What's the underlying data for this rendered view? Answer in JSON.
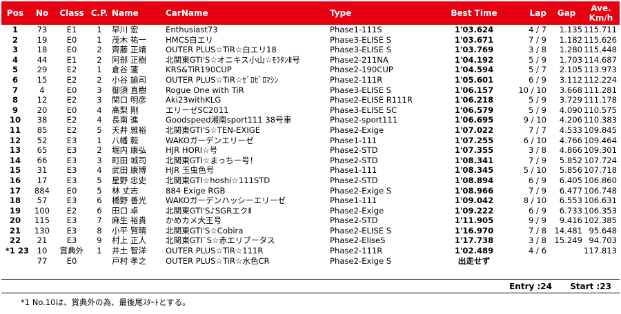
{
  "headers": {
    "pos": "Pos",
    "no": "No",
    "class": "Class",
    "cp": "C.P.",
    "name": "Name",
    "carname": "CarName",
    "type": "Type",
    "best": "Best Time",
    "lap": "Lap",
    "gap": "Gap",
    "ave1": "Ave.",
    "ave2": "Km/h"
  },
  "rows": [
    {
      "pos": "1",
      "no": "73",
      "cls": "E1",
      "cp": "1",
      "name": "早川 宏",
      "car": "Enthusiast73",
      "type": "Phase1-111S",
      "best": "1'03.624",
      "lap": "4 / 7",
      "gap": "1.135",
      "ave": "115.711"
    },
    {
      "pos": "2",
      "no": "19",
      "cls": "E0",
      "cp": "1",
      "name": "茂木 祐一",
      "car": "HMCS白エリ",
      "type": "Phase3-ELISE S",
      "best": "1'03.671",
      "lap": "7 / 9",
      "gap": "1.182",
      "ave": "115.626"
    },
    {
      "pos": "3",
      "no": "18",
      "cls": "E0",
      "cp": "2",
      "name": "齊藤 正靖",
      "car": "OUTER PLUS☆TiR☆白エリ18",
      "type": "Phase3-ELISE S",
      "best": "1'03.769",
      "lap": "3 / 8",
      "gap": "1.280",
      "ave": "115.448"
    },
    {
      "pos": "4",
      "no": "44",
      "cls": "E1",
      "cp": "2",
      "name": "阿部 正樹",
      "car": "北関東GTI'S☆オニキス小山☆ﾓﾗﾀﾝⅡ号",
      "type": "Phase2-211NA",
      "best": "1'04.192",
      "lap": "5 / 9",
      "gap": "1.703",
      "ave": "114.687"
    },
    {
      "pos": "5",
      "no": "29",
      "cls": "E2",
      "cp": "1",
      "name": "倉谷 蓮",
      "car": "KRS&TiR190CUP",
      "type": "Phase2-190CUP",
      "best": "1'04.594",
      "lap": "5 / 7",
      "gap": "2.105",
      "ave": "113.973"
    },
    {
      "pos": "6",
      "no": "15",
      "cls": "E2",
      "cp": "2",
      "name": "小谷 諭司",
      "car": "OUTER PLUS☆TiR☆ｾﾞﾛｾﾞﾛﾏｼﾝ",
      "type": "Phase2-111R",
      "best": "1'05.601",
      "lap": "6 / 9",
      "gap": "3.112",
      "ave": "112.224"
    },
    {
      "pos": "7",
      "no": "4",
      "cls": "E0",
      "cp": "3",
      "name": "御須 直樹",
      "car": "Rogue One with TiR",
      "type": "Phase3-ELISE S",
      "best": "1'06.157",
      "lap": "10 / 10",
      "gap": "3.668",
      "ave": "111.281"
    },
    {
      "pos": "8",
      "no": "12",
      "cls": "E2",
      "cp": "3",
      "name": "関口 明彦",
      "car": "Aki23withKLG",
      "type": "Phase2-ELISE R111R",
      "best": "1'06.218",
      "lap": "5 / 9",
      "gap": "3.729",
      "ave": "111.178"
    },
    {
      "pos": "9",
      "no": "20",
      "cls": "E0",
      "cp": "4",
      "name": "高梨 剛",
      "car": "エリーゼSC2011",
      "type": "Phase3-ELISE SC",
      "best": "1'06.579",
      "lap": "5 / 9",
      "gap": "4.090",
      "ave": "110.575"
    },
    {
      "pos": "10",
      "no": "38",
      "cls": "E2",
      "cp": "4",
      "name": "長南 進",
      "car": "Goodspeed湘南sport111 38号車",
      "type": "Phase2-sport111",
      "best": "1'06.695",
      "lap": "9 / 10",
      "gap": "4.206",
      "ave": "110.383"
    },
    {
      "pos": "11",
      "no": "85",
      "cls": "E2",
      "cp": "5",
      "name": "天井 雅裕",
      "car": "北関東GTI'S☆TEN-EXIGE",
      "type": "Phase2-Exige",
      "best": "1'07.022",
      "lap": "7 / 7",
      "gap": "4.533",
      "ave": "109.845"
    },
    {
      "pos": "12",
      "no": "52",
      "cls": "E3",
      "cp": "1",
      "name": "八幡 毅",
      "car": "WAKOガーデンエリーゼ",
      "type": "Phase1-111",
      "best": "1'07.255",
      "lap": "6 / 10",
      "gap": "4.766",
      "ave": "109.464"
    },
    {
      "pos": "13",
      "no": "65",
      "cls": "E3",
      "cp": "2",
      "name": "堀内 康弘",
      "car": "HJR HORI☆号",
      "type": "Phase2-STD",
      "best": "1'07.355",
      "lap": "3 / 8",
      "gap": "4.866",
      "ave": "109.301"
    },
    {
      "pos": "14",
      "no": "66",
      "cls": "E3",
      "cp": "3",
      "name": "町田 城司",
      "car": "北関東GTI☆まっちー号！",
      "type": "Phase2-STD",
      "best": "1'08.341",
      "lap": "7 / 9",
      "gap": "5.852",
      "ave": "107.724"
    },
    {
      "pos": "15",
      "no": "31",
      "cls": "E3",
      "cp": "4",
      "name": "武田 康博",
      "car": "HJR 玉虫色号",
      "type": "Phase1-111",
      "best": "1'08.345",
      "lap": "5 / 10",
      "gap": "5.856",
      "ave": "107.718"
    },
    {
      "pos": "16",
      "no": "17",
      "cls": "E3",
      "cp": "5",
      "name": "星野 忠史",
      "car": "北関東GTI☆hoshi☆111STD",
      "type": "Phase2-STD",
      "best": "1'08.894",
      "lap": "6 / 9",
      "gap": "6.405",
      "ave": "106.860"
    },
    {
      "pos": "17",
      "no": "884",
      "cls": "E0",
      "cp": "5",
      "name": "林 丈志",
      "car": "884 Exige RGB",
      "type": "Phase2-Exige S",
      "best": "1'08.966",
      "lap": "7 / 9",
      "gap": "6.477",
      "ave": "106.748"
    },
    {
      "pos": "18",
      "no": "57",
      "cls": "E3",
      "cp": "6",
      "name": "橋野 善光",
      "car": "WAKOガーデンハッシーエリーゼ",
      "type": "Phase1-111",
      "best": "1'09.042",
      "lap": "8 / 10",
      "gap": "6.553",
      "ave": "106.631"
    },
    {
      "pos": "19",
      "no": "100",
      "cls": "E2",
      "cp": "6",
      "name": "田口 卓",
      "car": "北関東GTI'S♪SGRエクⅡ",
      "type": "Phase2-Exige",
      "best": "1'09.222",
      "lap": "6 / 9",
      "gap": "6.733",
      "ave": "106.353"
    },
    {
      "pos": "20",
      "no": "115",
      "cls": "E3",
      "cp": "7",
      "name": "麻生 裕貴",
      "car": "かめカメ大王号",
      "type": "Phase2-STD",
      "best": "1'11.905",
      "lap": "9 / 9",
      "gap": "9.416",
      "ave": "102.385"
    },
    {
      "pos": "21",
      "no": "130",
      "cls": "E3",
      "cp": "8",
      "name": "小平 賢晴",
      "car": "北関東GTI'S☆Cobira",
      "type": "Phase2-ELISE S",
      "best": "1'16.970",
      "lap": "7 / 8",
      "gap": "14.481",
      "ave": "95.648"
    },
    {
      "pos": "22",
      "no": "21",
      "cls": "E3",
      "cp": "9",
      "name": "村上 正人",
      "car": "北関東GTI`S☆赤エリブータス",
      "type": "Phase2-EliseS",
      "best": "1'17.738",
      "lap": "3 / 8",
      "gap": "15.249",
      "ave": "94.703"
    },
    {
      "pos": "*1 23",
      "no": "10",
      "cls": "賞典外",
      "cp": "1",
      "name": "井土 智洋",
      "car": "OUTER PLUS☆TiR☆111R",
      "type": "Phase2-111R",
      "best": "1'02.489",
      "lap": "4 / 6",
      "gap": "",
      "ave": "117.813"
    },
    {
      "pos": "",
      "no": "77",
      "cls": "E0",
      "cp": "",
      "name": "戸村 孝之",
      "car": "OUTER PLUS☆TiR☆水色CR",
      "type": "Phase2-Exige S",
      "best": "出走せず",
      "lap": "",
      "gap": "",
      "ave": ""
    }
  ],
  "summary": {
    "entry": "Entry :24",
    "start": "Start :23"
  },
  "note": "*1 No.10は、賞典外の為、最後尾ｽﾀｰﾄとする。",
  "colors": {
    "header_bg": "#e60012",
    "header_text": "#ffffff"
  }
}
